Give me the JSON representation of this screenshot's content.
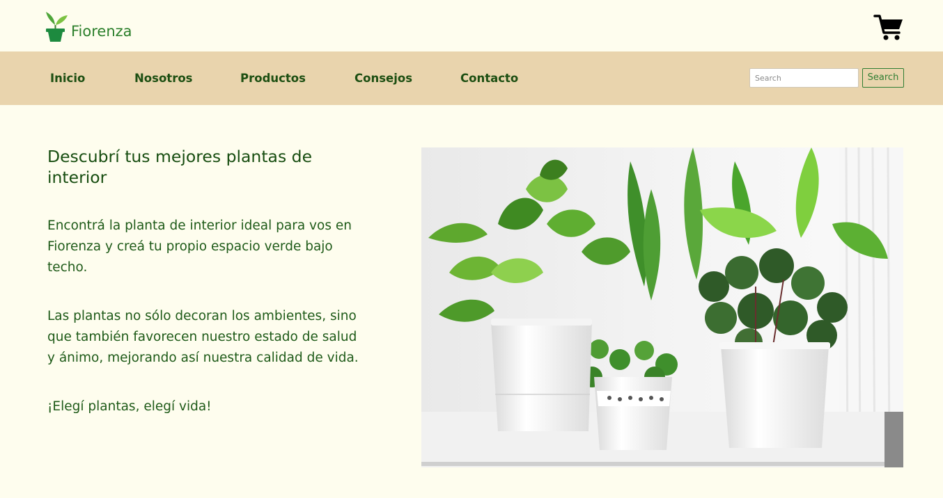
{
  "header": {
    "brand_name": "Fiorenza",
    "logo_icon": "potted-plant-icon",
    "cart_icon": "shopping-cart-icon"
  },
  "nav": {
    "items": [
      {
        "label": "Inicio"
      },
      {
        "label": "Nosotros"
      },
      {
        "label": "Productos"
      },
      {
        "label": "Consejos"
      },
      {
        "label": "Contacto"
      }
    ],
    "search": {
      "placeholder": "Search",
      "value": "",
      "button_label": "Search"
    }
  },
  "hero": {
    "title": "Descubrí tus mejores plantas de interior",
    "paragraphs": [
      "Encontrá la planta de interior ideal para vos en Fiorenza y creá tu propio espacio verde bajo techo.",
      "Las plantas no sólo decoran los ambientes, sino que también favorecen nuestro estado de salud y ánimo, mejorando así nuestra calidad de vida.",
      "¡Elegí plantas, elegí vida!"
    ]
  },
  "colors": {
    "page_background": "#fefdee",
    "nav_background": "#e9d4ad",
    "nav_text": "#1d4f12",
    "brand_green": "#2b7f2b",
    "body_text": "#1e5a18"
  }
}
